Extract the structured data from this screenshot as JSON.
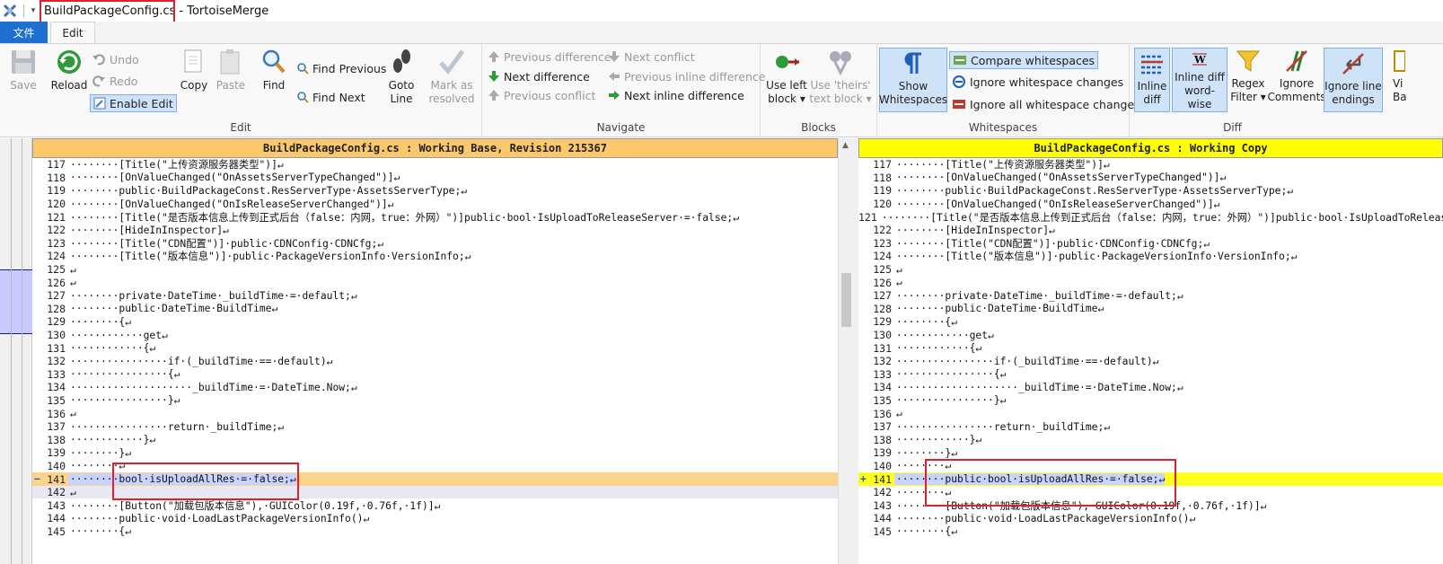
{
  "window": {
    "title": "BuildPackageConfig.cs - TortoiseMerge"
  },
  "tabs": {
    "file": "文件",
    "edit": "Edit"
  },
  "ribbon": {
    "edit_group": {
      "label": "Edit",
      "save": "Save",
      "reload": "Reload",
      "undo": "Undo",
      "redo": "Redo",
      "enable_edit": "Enable Edit",
      "copy": "Copy",
      "paste": "Paste",
      "find": "Find",
      "find_previous": "Find Previous",
      "find_next": "Find Next",
      "goto_line_1": "Goto",
      "goto_line_2": "Line",
      "mark_resolved_1": "Mark as",
      "mark_resolved_2": "resolved"
    },
    "navigate_group": {
      "label": "Navigate",
      "previous_difference": "Previous difference",
      "next_difference": "Next difference",
      "previous_conflict": "Previous conflict",
      "next_conflict": "Next conflict",
      "previous_inline_difference": "Previous inline difference",
      "next_inline_difference": "Next inline difference"
    },
    "blocks_group": {
      "label": "Blocks",
      "use_left_1": "Use left",
      "use_left_2": "block",
      "use_theirs_1": "Use 'theirs'",
      "use_theirs_2": "text block"
    },
    "whitespaces_group": {
      "label": "Whitespaces",
      "show_ws_1": "Show",
      "show_ws_2": "Whitespaces",
      "compare_whitespaces": "Compare whitespaces",
      "ignore_whitespace_changes": "Ignore whitespace changes",
      "ignore_all_whitespace_changes": "Ignore all whitespace changes"
    },
    "diff_group": {
      "label": "Diff",
      "inline_diff_1": "Inline",
      "inline_diff_2": "diff",
      "inline_word_1": "Inline diff",
      "inline_word_2": "word-wise",
      "regex_1": "Regex",
      "regex_2": "Filter",
      "ignore_comments_1": "Ignore",
      "ignore_comments_2": "Comments",
      "ignore_line_endings_1": "Ignore line",
      "ignore_line_endings_2": "endings",
      "view_1": "Vi",
      "view_2": "Ba"
    }
  },
  "left_pane": {
    "header": "BuildPackageConfig.cs : Working Base, Revision 215367",
    "lines": [
      {
        "n": "117",
        "t": "········[Title(\"上传资源服务器类型\")]↵"
      },
      {
        "n": "118",
        "t": "········[OnValueChanged(\"OnAssetsServerTypeChanged\")]↵"
      },
      {
        "n": "119",
        "t": "········public·BuildPackageConst.ResServerType·AssetsServerType;↵"
      },
      {
        "n": "120",
        "t": "········[OnValueChanged(\"OnIsReleaseServerChanged\")]↵"
      },
      {
        "n": "121",
        "t": "········[Title(\"是否版本信息上传到正式后台（false：内网，true：外网）\")]public·bool·IsUploadToReleaseServer·=·false;↵"
      },
      {
        "n": "122",
        "t": "········[HideInInspector]↵"
      },
      {
        "n": "123",
        "t": "········[Title(\"CDN配置\")]·public·CDNConfig·CDNCfg;↵"
      },
      {
        "n": "124",
        "t": "········[Title(\"版本信息\")]·public·PackageVersionInfo·VersionInfo;↵"
      },
      {
        "n": "125",
        "t": "↵"
      },
      {
        "n": "126",
        "t": "↵"
      },
      {
        "n": "127",
        "t": "········private·DateTime·_buildTime·=·default;↵"
      },
      {
        "n": "128",
        "t": "········public·DateTime·BuildTime↵"
      },
      {
        "n": "129",
        "t": "········{↵"
      },
      {
        "n": "130",
        "t": "············get↵"
      },
      {
        "n": "131",
        "t": "············{↵"
      },
      {
        "n": "132",
        "t": "················if·(_buildTime·==·default)↵"
      },
      {
        "n": "133",
        "t": "················{↵"
      },
      {
        "n": "134",
        "t": "····················_buildTime·=·DateTime.Now;↵"
      },
      {
        "n": "135",
        "t": "················}↵"
      },
      {
        "n": "136",
        "t": "↵"
      },
      {
        "n": "137",
        "t": "················return·_buildTime;↵"
      },
      {
        "n": "138",
        "t": "············}↵"
      },
      {
        "n": "139",
        "t": "········}↵"
      },
      {
        "n": "140",
        "t": "········↵"
      },
      {
        "n": "141",
        "t": "········bool·isUploadAllRes·=·false;↵",
        "state": "changed",
        "mark": "−"
      },
      {
        "n": "142",
        "t": "↵",
        "state": "ghost"
      },
      {
        "n": "143",
        "t": "········[Button(\"加载包版本信息\"),·GUIColor(0.19f,·0.76f,·1f)]↵"
      },
      {
        "n": "144",
        "t": "········public·void·LoadLastPackageVersionInfo()↵"
      },
      {
        "n": "145",
        "t": "········{↵"
      }
    ]
  },
  "right_pane": {
    "header": "BuildPackageConfig.cs : Working Copy",
    "lines": [
      {
        "n": "117",
        "t": "········[Title(\"上传资源服务器类型\")]↵"
      },
      {
        "n": "118",
        "t": "········[OnValueChanged(\"OnAssetsServerTypeChanged\")]↵"
      },
      {
        "n": "119",
        "t": "········public·BuildPackageConst.ResServerType·AssetsServerType;↵"
      },
      {
        "n": "120",
        "t": "········[OnValueChanged(\"OnIsReleaseServerChanged\")]↵"
      },
      {
        "n": "121",
        "t": "········[Title(\"是否版本信息上传到正式后台（false：内网，true：外网）\")]public·bool·IsUploadToReleaseServer·=·false;↵"
      },
      {
        "n": "122",
        "t": "········[HideInInspector]↵"
      },
      {
        "n": "123",
        "t": "········[Title(\"CDN配置\")]·public·CDNConfig·CDNCfg;↵"
      },
      {
        "n": "124",
        "t": "········[Title(\"版本信息\")]·public·PackageVersionInfo·VersionInfo;↵"
      },
      {
        "n": "125",
        "t": "↵"
      },
      {
        "n": "126",
        "t": "↵"
      },
      {
        "n": "127",
        "t": "········private·DateTime·_buildTime·=·default;↵"
      },
      {
        "n": "128",
        "t": "········public·DateTime·BuildTime↵"
      },
      {
        "n": "129",
        "t": "········{↵"
      },
      {
        "n": "130",
        "t": "············get↵"
      },
      {
        "n": "131",
        "t": "············{↵"
      },
      {
        "n": "132",
        "t": "················if·(_buildTime·==·default)↵"
      },
      {
        "n": "133",
        "t": "················{↵"
      },
      {
        "n": "134",
        "t": "····················_buildTime·=·DateTime.Now;↵"
      },
      {
        "n": "135",
        "t": "················}↵"
      },
      {
        "n": "136",
        "t": "↵"
      },
      {
        "n": "137",
        "t": "················return·_buildTime;↵"
      },
      {
        "n": "138",
        "t": "············}↵"
      },
      {
        "n": "139",
        "t": "········}↵"
      },
      {
        "n": "140",
        "t": "········↵"
      },
      {
        "n": "141",
        "t": "········public·bool·isUploadAllRes·=·false;↵",
        "state": "changed",
        "mark": "+"
      },
      {
        "n": "142",
        "t": "········↵"
      },
      {
        "n": "143",
        "t": "········[Button(\"加载包版本信息\"),·GUIColor(0.19f,·0.76f,·1f)]↵"
      },
      {
        "n": "144",
        "t": "········public·void·LoadLastPackageVersionInfo()↵"
      },
      {
        "n": "145",
        "t": "········{↵"
      }
    ]
  },
  "colors": {
    "left_header": "#fbc96b",
    "right_header": "#ffff00",
    "left_changed": "#fbd38a",
    "right_changed": "#ffff20",
    "annotation_red": "#e0202a",
    "file_tab_blue": "#1e6fd0"
  }
}
